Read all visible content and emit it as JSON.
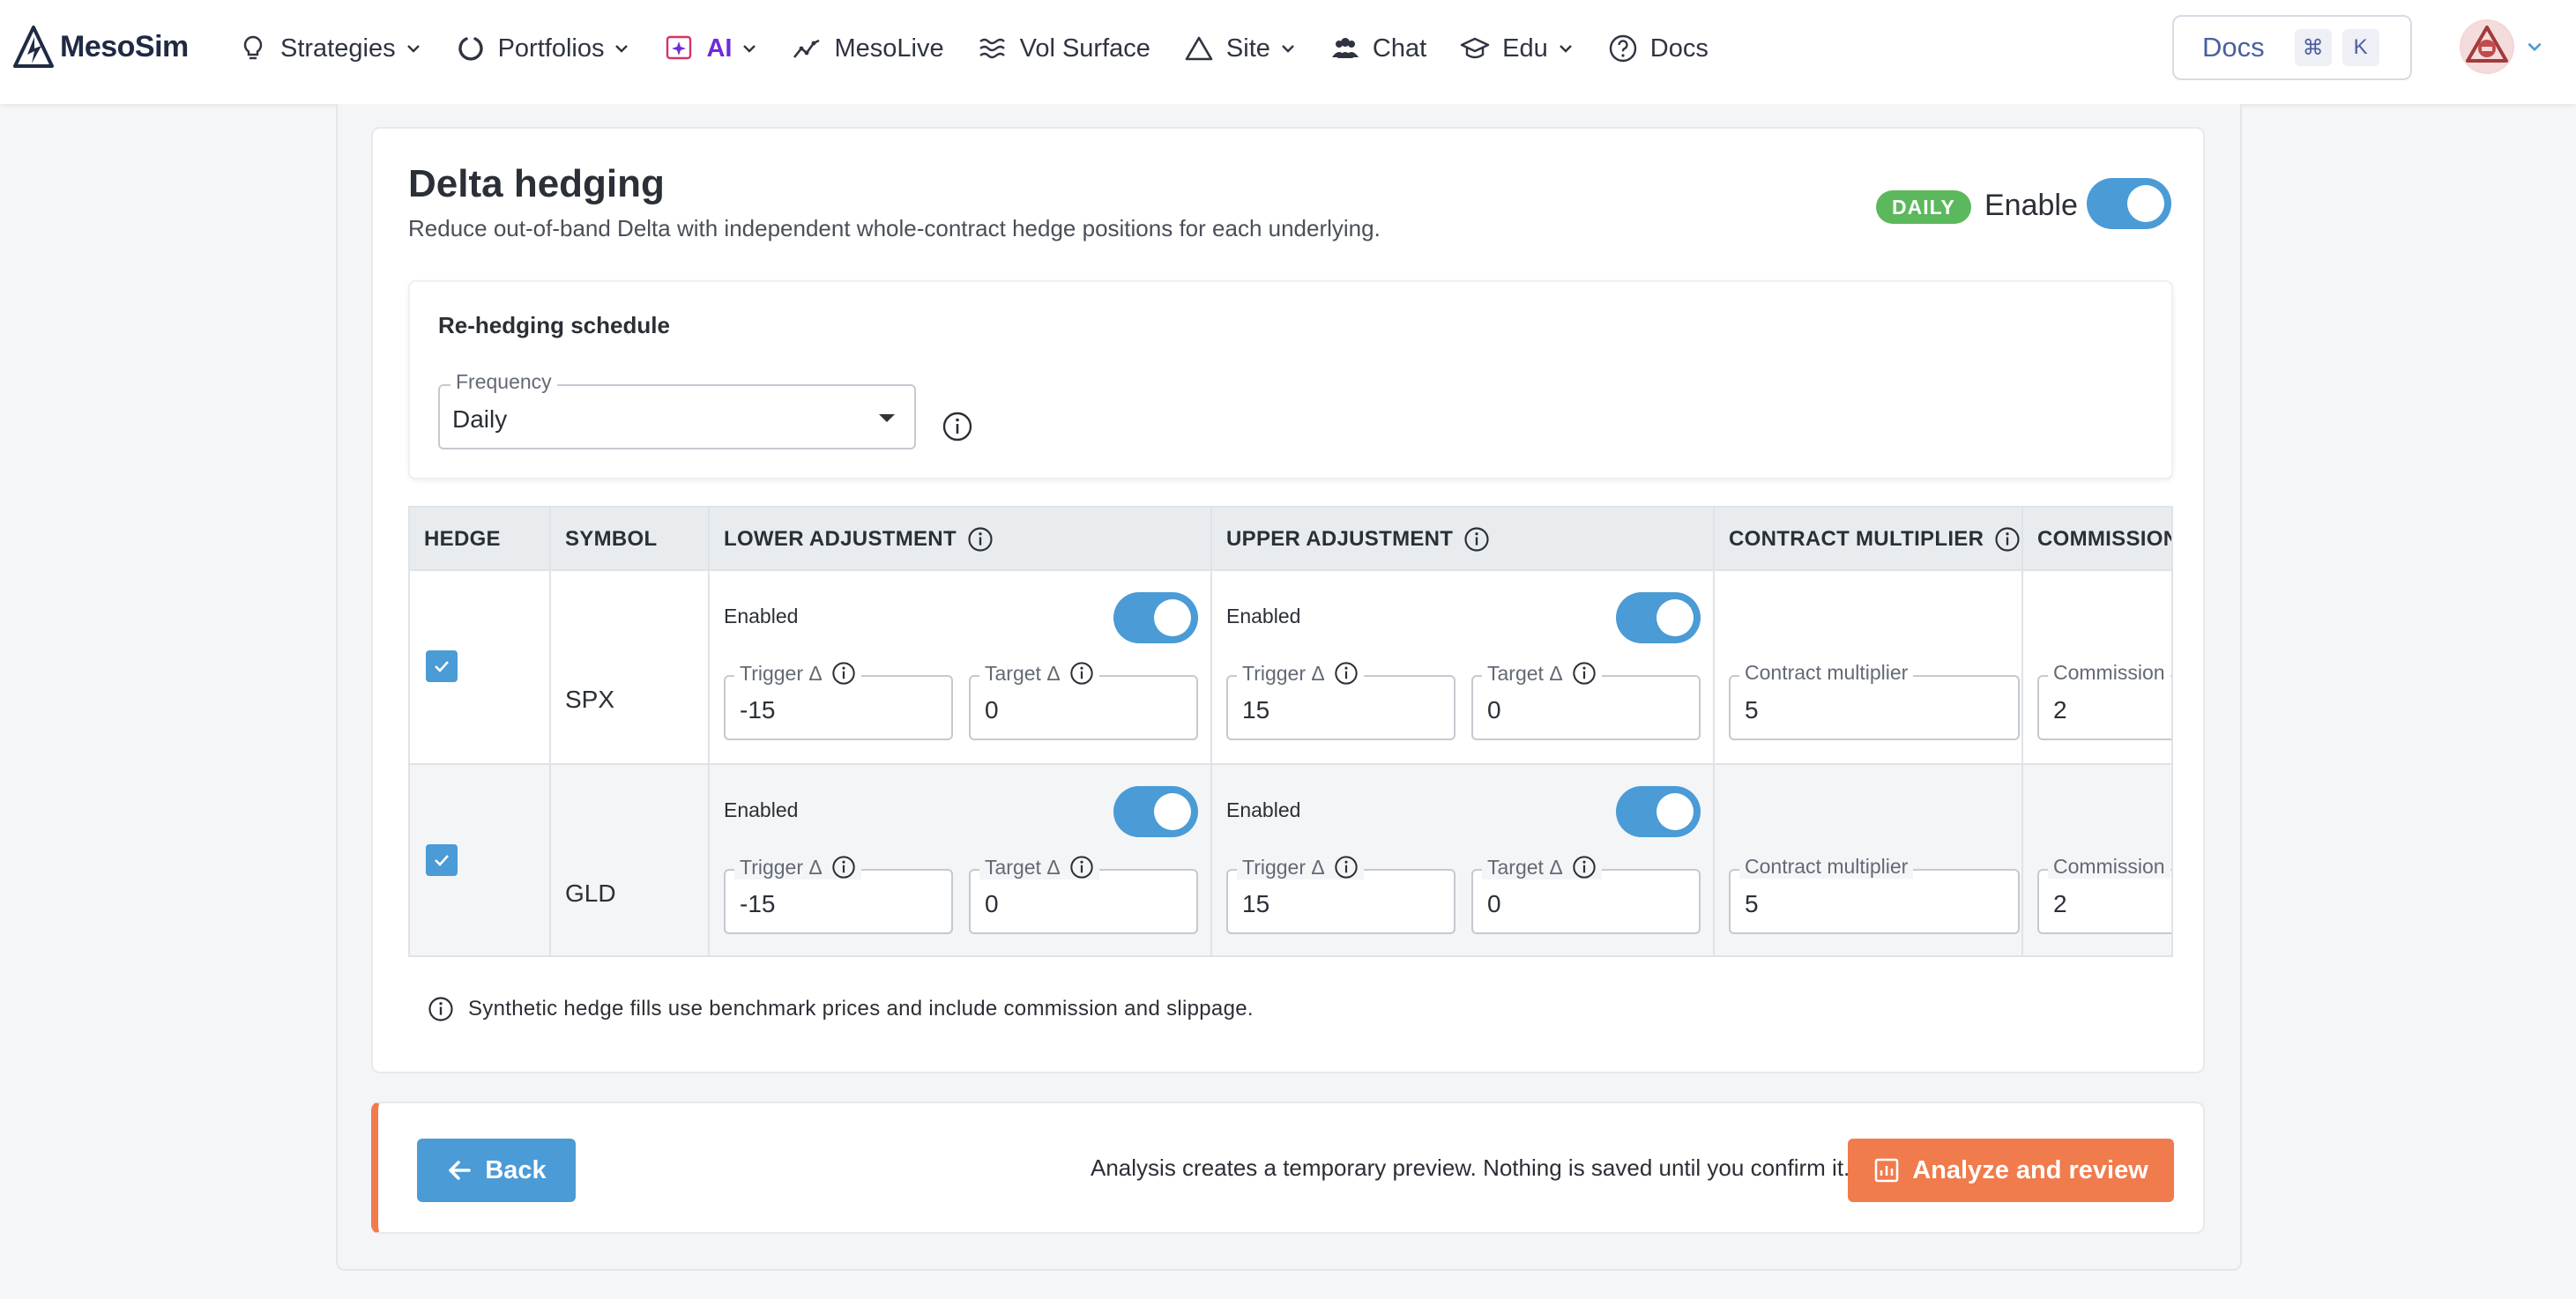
{
  "navbar": {
    "brand": "MesoSim",
    "items": [
      {
        "label": "Strategies",
        "icon": "lightbulb-icon",
        "dropdown": true
      },
      {
        "label": "Portfolios",
        "icon": "circle-notch-icon",
        "dropdown": true
      },
      {
        "label": "AI",
        "icon": "ai-sparkle-icon",
        "dropdown": true
      },
      {
        "label": "MesoLive",
        "icon": "line-chart-icon",
        "dropdown": false
      },
      {
        "label": "Vol Surface",
        "icon": "waves-icon",
        "dropdown": false
      },
      {
        "label": "Site",
        "icon": "triangle-icon",
        "dropdown": true
      },
      {
        "label": "Chat",
        "icon": "users-icon",
        "dropdown": false
      },
      {
        "label": "Edu",
        "icon": "graduation-cap-icon",
        "dropdown": true
      },
      {
        "label": "Docs",
        "icon": "question-circle-icon",
        "dropdown": false
      }
    ],
    "docs_search": {
      "label": "Docs",
      "key1": "⌘",
      "key2": "K"
    },
    "ai_color": "#6f2bd9"
  },
  "section": {
    "title": "Delta hedging",
    "subtitle": "Reduce out-of-band Delta with independent whole-contract hedge positions for each underlying.",
    "badge": "DAILY",
    "enable_label": "Enable",
    "enabled": true
  },
  "schedule": {
    "title": "Re-hedging schedule",
    "frequency_label": "Frequency",
    "frequency_value": "Daily"
  },
  "table": {
    "headers": {
      "hedge": "HEDGE",
      "symbol": "SYMBOL",
      "lower": "LOWER ADJUSTMENT",
      "upper": "UPPER ADJUSTMENT",
      "multiplier": "CONTRACT MULTIPLIER",
      "commission": "COMMISSION"
    },
    "labels": {
      "enabled": "Enabled",
      "trigger": "Trigger Δ",
      "target": "Target Δ",
      "multiplier": "Contract multiplier",
      "commission": "Commission"
    },
    "rows": [
      {
        "hedge": true,
        "symbol": "SPX",
        "lower_enabled": true,
        "lower_trigger": "-15",
        "lower_target": "0",
        "upper_enabled": true,
        "upper_trigger": "15",
        "upper_target": "0",
        "multiplier": "5",
        "commission": "2"
      },
      {
        "hedge": true,
        "symbol": "GLD",
        "lower_enabled": true,
        "lower_trigger": "-15",
        "lower_target": "0",
        "upper_enabled": true,
        "upper_trigger": "15",
        "upper_target": "0",
        "multiplier": "5",
        "commission": "2"
      }
    ]
  },
  "note": "Synthetic hedge fills use benchmark prices and include commission and slippage.",
  "footer": {
    "back_label": "Back",
    "info_text": "Analysis creates a temporary preview. Nothing is saved until you confirm it.",
    "analyze_label": "Analyze and review"
  },
  "colors": {
    "accent_blue": "#4a9bd6",
    "accent_orange": "#f07b4c",
    "badge_green": "#5cb85c"
  }
}
